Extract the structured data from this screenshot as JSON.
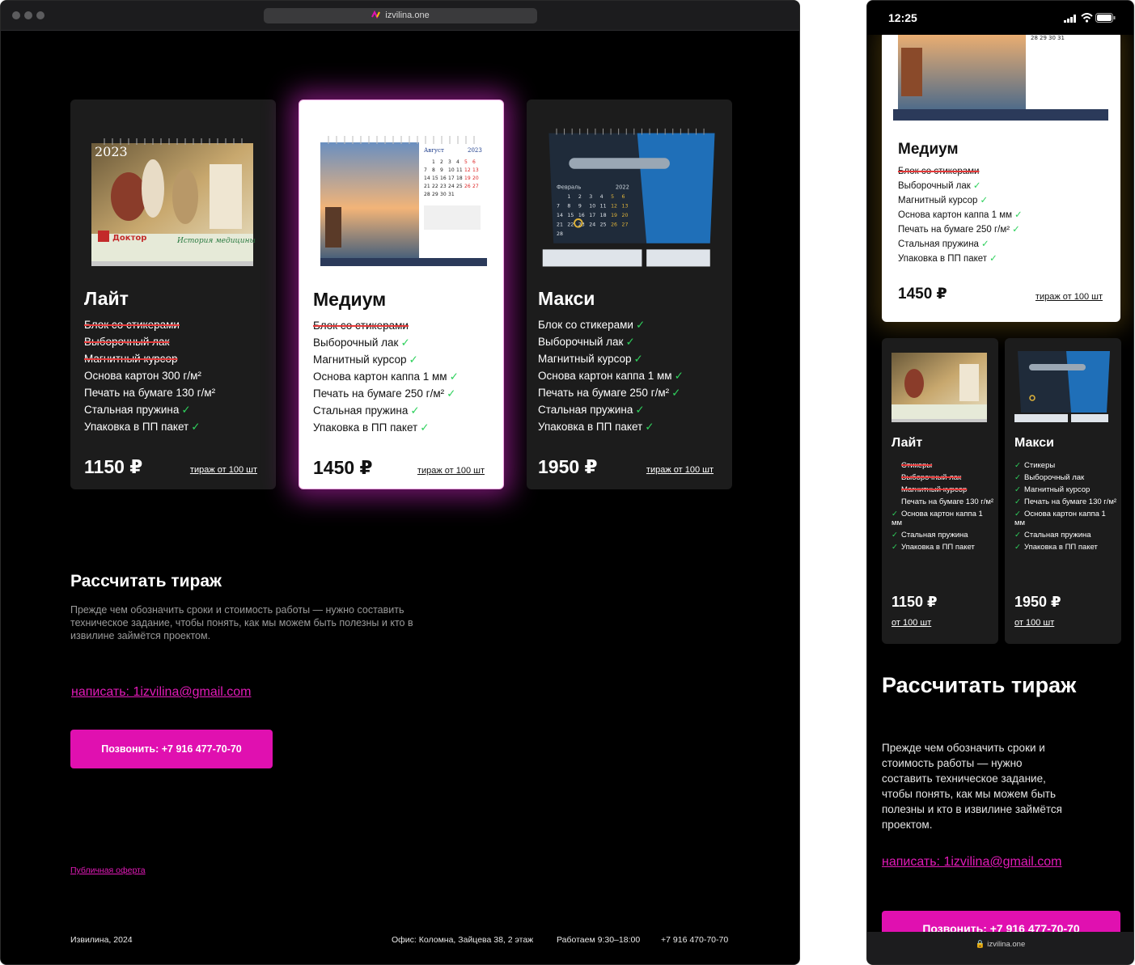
{
  "browser": {
    "url": "izvilina.one"
  },
  "plans": [
    {
      "name": "Лайт",
      "features": [
        {
          "text": "Блок со стикерами",
          "strike": true,
          "check": false
        },
        {
          "text": "Выборочный лак",
          "strike": true,
          "check": false
        },
        {
          "text": "Магнитный курсор",
          "strike": true,
          "check": false
        },
        {
          "text": "Основа картон 300 г/м²",
          "strike": false,
          "check": false
        },
        {
          "text": "Печать на бумаге 130 г/м²",
          "strike": false,
          "check": false
        },
        {
          "text": "Стальная пружина",
          "strike": false,
          "check": true
        },
        {
          "text": "Упаковка в ПП пакет",
          "strike": false,
          "check": true
        }
      ],
      "price": "1150 ₽",
      "batch": "тираж от 100 шт"
    },
    {
      "name": "Медиум",
      "features": [
        {
          "text": "Блок со стикерами",
          "strike": true,
          "check": false
        },
        {
          "text": "Выборочный лак",
          "strike": false,
          "check": true
        },
        {
          "text": "Магнитный курсор",
          "strike": false,
          "check": true
        },
        {
          "text": "Основа картон каппа 1 мм",
          "strike": false,
          "check": true
        },
        {
          "text": "Печать на бумаге 250 г/м²",
          "strike": false,
          "check": true
        },
        {
          "text": "Стальная пружина",
          "strike": false,
          "check": true
        },
        {
          "text": "Упаковка в ПП пакет",
          "strike": false,
          "check": true
        }
      ],
      "price": "1450 ₽",
      "batch": "тираж от 100 шт"
    },
    {
      "name": "Макси",
      "features": [
        {
          "text": "Блок со стикерами",
          "strike": false,
          "check": true
        },
        {
          "text": "Выборочный лак",
          "strike": false,
          "check": true
        },
        {
          "text": "Магнитный курсор",
          "strike": false,
          "check": true
        },
        {
          "text": "Основа картон каппа 1 мм",
          "strike": false,
          "check": true
        },
        {
          "text": "Печать на бумаге 250 г/м²",
          "strike": false,
          "check": true
        },
        {
          "text": "Стальная пружина",
          "strike": false,
          "check": true
        },
        {
          "text": "Упаковка в ПП пакет",
          "strike": false,
          "check": true
        }
      ],
      "price": "1950 ₽",
      "batch": "тираж от 100 шт"
    }
  ],
  "calc": {
    "title": "Рассчитать тираж",
    "lead": "Прежде чем обозначить сроки и стоимость работы — нужно составить техническое задание, чтобы понять, как мы можем быть полезны и кто в извилине займётся проектом.",
    "email": "написать: 1izvilina@gmail.com",
    "call": "Позвонить: +7 916 477-70-70"
  },
  "footer": {
    "offer": "Публичная оферта",
    "copyright": "Извилина, 2024",
    "office": "Офис: Коломна, Зайцева 38, 2 этаж",
    "hours": "Работаем 9:30–18:00",
    "phone": "+7 916 470-70-70"
  },
  "calendar_images": {
    "lite": {
      "year": "2023",
      "brand": "Доктор",
      "caption": "История медицины"
    },
    "medium": {
      "month": "Август",
      "year": "2023",
      "days": [
        [
          "",
          "1",
          "2",
          "3",
          "4",
          "5",
          "6"
        ],
        [
          "7",
          "8",
          "9",
          "10",
          "11",
          "12",
          "13"
        ],
        [
          "14",
          "15",
          "16",
          "17",
          "18",
          "19",
          "20"
        ],
        [
          "21",
          "22",
          "23",
          "24",
          "25",
          "26",
          "27"
        ],
        [
          "28",
          "29",
          "30",
          "31",
          "",
          "",
          ""
        ]
      ]
    },
    "maxi": {
      "year": "2022",
      "month": "Февраль",
      "days": [
        [
          "",
          "1",
          "2",
          "3",
          "4",
          "5",
          "6"
        ],
        [
          "7",
          "8",
          "9",
          "10",
          "11",
          "12",
          "13"
        ],
        [
          "14",
          "15",
          "16",
          "17",
          "18",
          "19",
          "20"
        ],
        [
          "21",
          "22",
          "23",
          "24",
          "25",
          "26",
          "27"
        ],
        [
          "28",
          "",
          "",
          "",
          "",
          "",
          ""
        ]
      ]
    }
  },
  "mobile": {
    "time": "12:25",
    "url": "izvilina.one",
    "top_card": {
      "name": "Медиум",
      "features": [
        {
          "text": "Блок со стикерами",
          "strike": true,
          "check": false
        },
        {
          "text": "Выборочный лак",
          "strike": false,
          "check": true
        },
        {
          "text": "Магнитный курсор",
          "strike": false,
          "check": true
        },
        {
          "text": "Основа картон каппа 1 мм",
          "strike": false,
          "check": true
        },
        {
          "text": "Печать на бумаге 250 г/м²",
          "strike": false,
          "check": true
        },
        {
          "text": "Стальная пружина",
          "strike": false,
          "check": true
        },
        {
          "text": "Упаковка в ПП пакет",
          "strike": false,
          "check": true
        }
      ],
      "price": "1450 ₽",
      "batch": "тираж от 100 шт",
      "calendar_days": [
        "28",
        "29",
        "30",
        "31"
      ]
    },
    "small_cards": [
      {
        "name": "Лайт",
        "features": [
          {
            "text": "Стикеры",
            "strike": true,
            "check": false
          },
          {
            "text": "Выборочный лак",
            "strike": true,
            "check": false
          },
          {
            "text": "Магнитный курсор",
            "strike": true,
            "check": false
          },
          {
            "text": "Печать на бумаге 130 г/м²",
            "strike": false,
            "check": false
          },
          {
            "text": "Основа картон каппа 1 мм",
            "strike": false,
            "check": true
          },
          {
            "text": "Стальная пружина",
            "strike": false,
            "check": true
          },
          {
            "text": "Упаковка в ПП пакет",
            "strike": false,
            "check": true
          }
        ],
        "price": "1150 ₽",
        "batch": "от 100 шт"
      },
      {
        "name": "Макси",
        "features": [
          {
            "text": "Стикеры",
            "strike": false,
            "check": true
          },
          {
            "text": "Выборочный лак",
            "strike": false,
            "check": true
          },
          {
            "text": "Магнитный курсор",
            "strike": false,
            "check": true
          },
          {
            "text": "Печать на бумаге 130 г/м²",
            "strike": false,
            "check": true
          },
          {
            "text": "Основа картон каппа 1 мм",
            "strike": false,
            "check": true
          },
          {
            "text": "Стальная пружина",
            "strike": false,
            "check": true
          },
          {
            "text": "Упаковка в ПП пакет",
            "strike": false,
            "check": true
          }
        ],
        "price": "1950 ₽",
        "batch": "от 100 шт"
      }
    ],
    "title": "Рассчитать тираж",
    "lead": "Прежде чем обозначить сроки и стоимость работы — нужно составить техническое задание, чтобы понять, как мы можем быть полезны и кто в извилине займётся проектом.",
    "email": "написать: 1izvilina@gmail.com",
    "call": "Позвонить: +7 916 477-70-70"
  },
  "colors": {
    "accent": "#e010b0",
    "check": "#2fd15d",
    "strike": "#e43a3a",
    "card_dark": "#1c1c1c"
  }
}
